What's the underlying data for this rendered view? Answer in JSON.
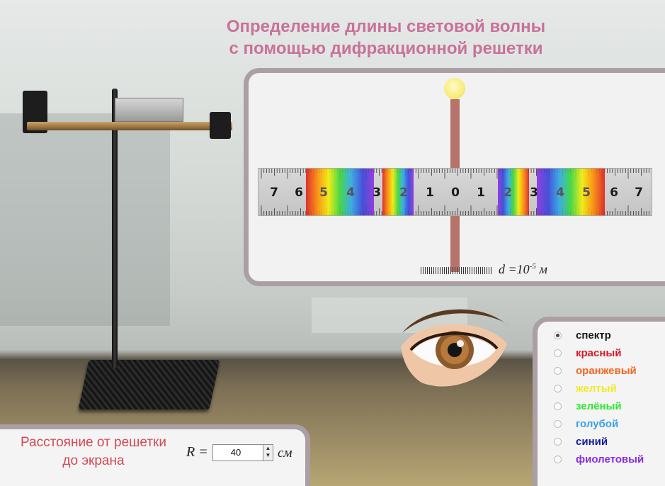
{
  "title": {
    "line1": "Определение длины световой волны",
    "line2": "с помощью дифракционной решетки"
  },
  "ruler": {
    "numbers_left": [
      "7",
      "6",
      "5",
      "4",
      "3",
      "2",
      "1"
    ],
    "center_number": "0",
    "numbers_right": [
      "1",
      "2",
      "3",
      "4",
      "5",
      "6",
      "7"
    ]
  },
  "grating_constant": {
    "label": "d =10",
    "exponent": "-5",
    "unit": "м"
  },
  "spectrum_options": {
    "items": [
      {
        "label": "спектр",
        "color": "#1a1a1a",
        "selected": true
      },
      {
        "label": "красный",
        "color": "#d7182a",
        "selected": false
      },
      {
        "label": "оранжевый",
        "color": "#f26522",
        "selected": false
      },
      {
        "label": "желтый",
        "color": "#f2e92b",
        "selected": false
      },
      {
        "label": "зелёный",
        "color": "#2ee82e",
        "selected": false
      },
      {
        "label": "голубой",
        "color": "#3aa0e8",
        "selected": false
      },
      {
        "label": "синий",
        "color": "#141a9e",
        "selected": false
      },
      {
        "label": "фиолетовый",
        "color": "#8a2be2",
        "selected": false
      }
    ]
  },
  "distance": {
    "label_line1": "Расстояние от решетки",
    "label_line2": "до экрана",
    "variable": "R =",
    "value": "40",
    "unit": "см"
  },
  "icons": {
    "lamp": "light-source-icon",
    "eye": "eye-icon",
    "stepper": "spin-stepper-icon"
  }
}
